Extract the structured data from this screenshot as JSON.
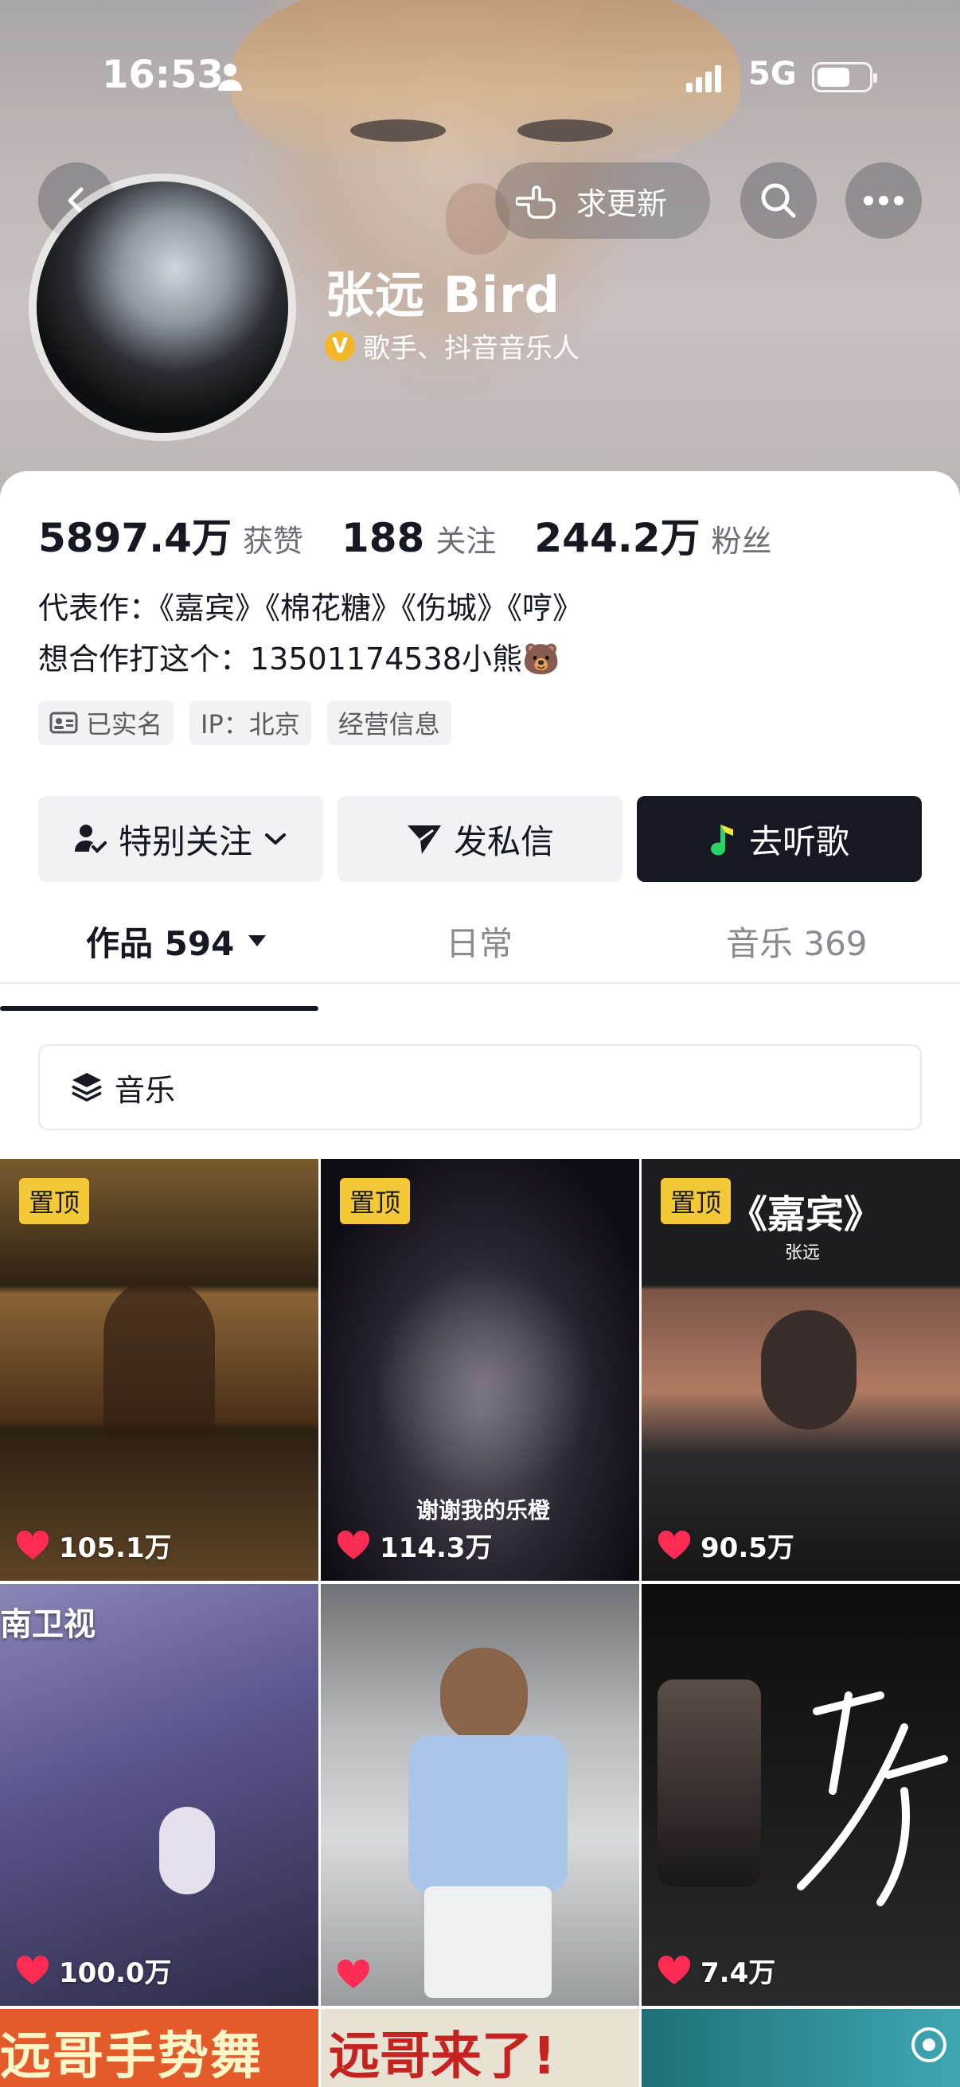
{
  "status_bar": {
    "time": "16:53",
    "network": "5G"
  },
  "header": {
    "request_update_label": "求更新",
    "name": "张远 Bird",
    "verified_badge": "V",
    "verification": "歌手、抖音音乐人"
  },
  "stats": [
    {
      "value": "5897.4万",
      "label": "获赞"
    },
    {
      "value": "188",
      "label": "关注"
    },
    {
      "value": "244.2万",
      "label": "粉丝"
    }
  ],
  "bio": {
    "line1": "代表作：《嘉宾》《棉花糖》《伤城》《哼》",
    "line2": "想合作打这个：13501174538小熊🐻"
  },
  "tags": {
    "real_name": "已实名",
    "ip": "IP：北京",
    "business": "经营信息"
  },
  "actions": {
    "follow": "特别关注",
    "message": "发私信",
    "listen": "去听歌"
  },
  "tabs": {
    "works": "作品 594",
    "daily": "日常",
    "music": "音乐 369"
  },
  "filter": {
    "label": "音乐"
  },
  "videos": [
    {
      "pinned": "置顶",
      "likes": "105.1万"
    },
    {
      "pinned": "置顶",
      "likes": "114.3万",
      "caption": "谢谢我的乐橙"
    },
    {
      "pinned": "置顶",
      "likes": "90.5万",
      "title": "《嘉宾》",
      "subtitle": "张远"
    },
    {
      "likes": "100.0万",
      "channel": "南卫视"
    },
    {
      "likes": ""
    },
    {
      "likes": "7.4万"
    },
    {
      "title": "远哥手势舞"
    },
    {
      "title": "远哥来了!"
    },
    {}
  ],
  "colors": {
    "accent_dark": "#161823",
    "pin_yellow": "#f5c835",
    "like_red": "#fe2c55",
    "music_green": "#25d366"
  }
}
